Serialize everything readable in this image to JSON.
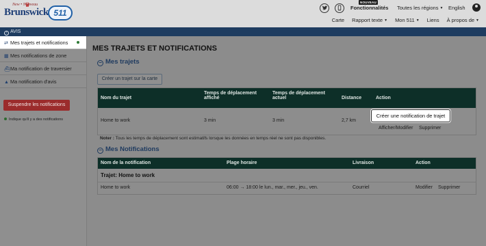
{
  "header": {
    "logo": {
      "small_text": "New • Nouveau",
      "big_text": "Brunswick",
      "badge_text": "511"
    },
    "icons": [
      "twitter-icon",
      "mobile-icon"
    ],
    "features_badge": "NOUVEAU",
    "features_label": "Fonctionnalités",
    "regions_label": "Toutes les régions",
    "language_label": "English",
    "user_icon": "user-icon"
  },
  "subnav": {
    "items": [
      "Carte",
      "Rapport texte",
      "Mon 511",
      "Liens",
      "À propos de"
    ]
  },
  "alert_bar": {
    "label": "AVIS"
  },
  "sidebar": {
    "items": [
      {
        "label": "Mes trajets et notifications",
        "icon": "route-icon",
        "active": true
      },
      {
        "label": "Mes notifications de zone",
        "icon": "map-icon"
      },
      {
        "label": "Ma notification de traversier",
        "icon": "ferry-icon"
      },
      {
        "label": "Ma notification d'avis",
        "icon": "alert-icon"
      }
    ],
    "suspend_button": "Suspendre les notifications",
    "legend_text": "Indique qu'il y a des notifications"
  },
  "main": {
    "title": "MES TRAJETS ET NOTIFICATIONS",
    "trips_section": {
      "title": "Mes trajets",
      "create_button": "Créer un trajet sur la carte",
      "headers": [
        "Nom du trajet",
        "Temps de déplacement affiché",
        "Temps de déplacement actuel",
        "Distance",
        "Action"
      ],
      "rows": [
        {
          "name": "Home to work",
          "displayed_time": "3 min",
          "current_time": "3 min",
          "distance": "2,7 km",
          "action_edit": "Afficher/Modifier",
          "action_delete": "Supprimer"
        }
      ],
      "tooltip": "Créer une notification de trajet"
    },
    "note_label": "Noter :",
    "note_text": "Tous les temps de déplacement sont estimatifs lorsque les données en temps réel ne sont pas disponibles.",
    "notif_section": {
      "title": "Mes Notifications",
      "headers": [
        "Nom de la notification",
        "Plage horaire",
        "Livraison",
        "Action"
      ],
      "group_label": "Trajet: Home to work",
      "rows": [
        {
          "name": "Home to work",
          "schedule": "06:00 → 18:00 le lun., mar., mer., jeu., ven.",
          "delivery": "Courriel",
          "action_edit": "Modifier",
          "action_delete": "Supprimer"
        }
      ]
    }
  }
}
